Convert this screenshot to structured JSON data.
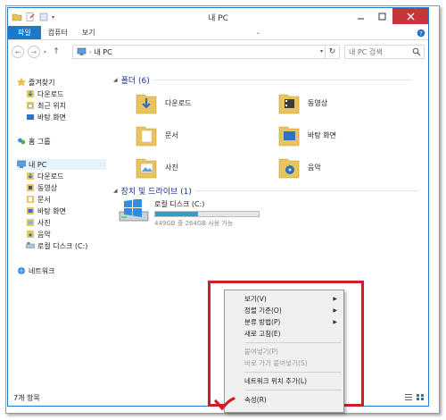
{
  "window": {
    "title": "내 PC"
  },
  "ribbon": {
    "tabs": [
      "파일",
      "컴퓨터",
      "보기"
    ]
  },
  "address": {
    "path_label": "내 PC",
    "search_placeholder": "내 PC 검색"
  },
  "nav": {
    "favorites": {
      "label": "즐겨찾기",
      "items": [
        "다운로드",
        "최근 위치",
        "바탕 화면"
      ]
    },
    "homegroup": "홈 그룹",
    "thispc": {
      "label": "내 PC",
      "items": [
        "다운로드",
        "동영상",
        "문서",
        "바탕 화면",
        "사진",
        "음악",
        "로컬 디스크 (C:)"
      ]
    },
    "network": "네트워크"
  },
  "folders": {
    "header": "폴더 (6)",
    "items": [
      "다운로드",
      "동영상",
      "문서",
      "바탕 화면",
      "사진",
      "음악"
    ]
  },
  "drives": {
    "header": "장치 및 드라이브 (1)",
    "name": "로컬 디스크 (C:)",
    "usage_text": "449GB 중 264GB 사용 가능",
    "used_fraction": 0.41
  },
  "status": {
    "count": "7개 항목"
  },
  "context_menu": {
    "items": [
      {
        "label": "보기(V)",
        "submenu": true,
        "disabled": false
      },
      {
        "label": "정렬 기준(O)",
        "submenu": true,
        "disabled": false
      },
      {
        "label": "분류 방법(P)",
        "submenu": true,
        "disabled": false
      },
      {
        "label": "새로 고침(E)",
        "submenu": false,
        "disabled": false
      },
      {
        "label": "붙여넣기(P)",
        "submenu": false,
        "disabled": true
      },
      {
        "label": "바로 가기 붙여넣기(S)",
        "submenu": false,
        "disabled": true
      },
      {
        "label": "네트워크 위치 추가(L)",
        "submenu": false,
        "disabled": false
      },
      {
        "label": "속성(R)",
        "submenu": false,
        "disabled": false
      }
    ]
  },
  "colors": {
    "accent": "#1979ca",
    "highlight": "#d11d27",
    "close": "#c7343d"
  }
}
